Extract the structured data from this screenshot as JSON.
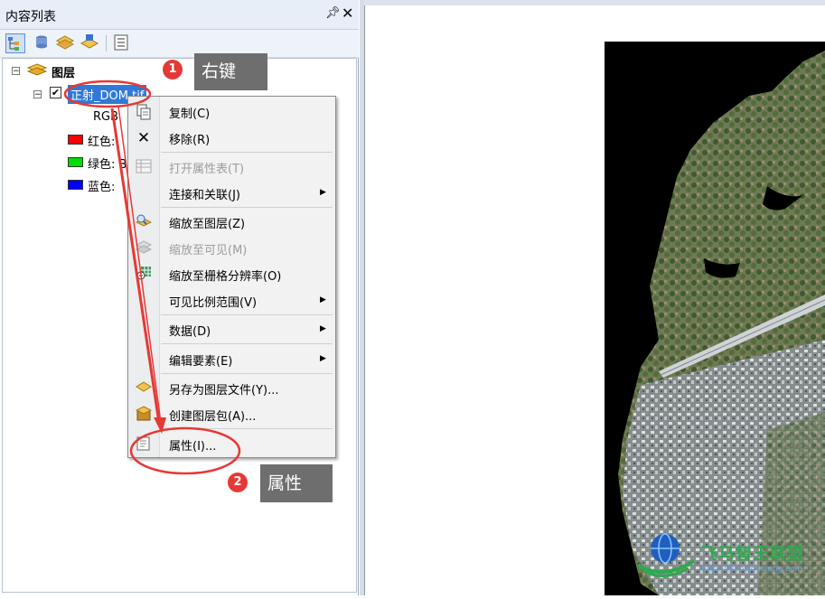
{
  "toc": {
    "title": "内容列表",
    "pin_icon": "pin-icon",
    "close_icon": "close-icon",
    "layers_root": "图层",
    "layer_name": "正射_DOM.tif",
    "rgb_label": "RGB",
    "bands": [
      {
        "label": "红色:",
        "color": "#ff0000"
      },
      {
        "label": "绿色: B",
        "color": "#00dd00"
      },
      {
        "label": "蓝色:",
        "color": "#0000ff"
      }
    ]
  },
  "context_menu": {
    "items": [
      {
        "label": "复制(C)",
        "enabled": true,
        "icon": "copy-icon"
      },
      {
        "label": "移除(R)",
        "enabled": true,
        "icon": "remove-x-icon"
      },
      {
        "label": "打开属性表(T)",
        "enabled": false,
        "icon": "table-icon"
      },
      {
        "label": "连接和关联(J)",
        "enabled": true,
        "submenu": true
      },
      {
        "label": "缩放至图层(Z)",
        "enabled": true,
        "icon": "zoom-layer-icon"
      },
      {
        "label": "缩放至可见(M)",
        "enabled": false,
        "icon": "zoom-visible-icon"
      },
      {
        "label": "缩放至栅格分辨率(O)",
        "enabled": true,
        "icon": "raster-resolution-icon"
      },
      {
        "label": "可见比例范围(V)",
        "enabled": true,
        "submenu": true
      },
      {
        "label": "数据(D)",
        "enabled": true,
        "submenu": true
      },
      {
        "label": "编辑要素(E)",
        "enabled": true,
        "submenu": true
      },
      {
        "label": "另存为图层文件(Y)...",
        "enabled": true,
        "icon": "save-layer-icon"
      },
      {
        "label": "创建图层包(A)...",
        "enabled": true,
        "icon": "layer-package-icon"
      },
      {
        "label": "属性(I)...",
        "enabled": true,
        "icon": "properties-icon"
      }
    ]
  },
  "annotations": {
    "step1_number": "1",
    "step1_text": "右键",
    "step2_number": "2",
    "step2_text": "属性",
    "accent_color": "#e53935"
  },
  "watermark": {
    "text": "飞马智王联盟",
    "url": "http://feimazhiwang.com"
  }
}
